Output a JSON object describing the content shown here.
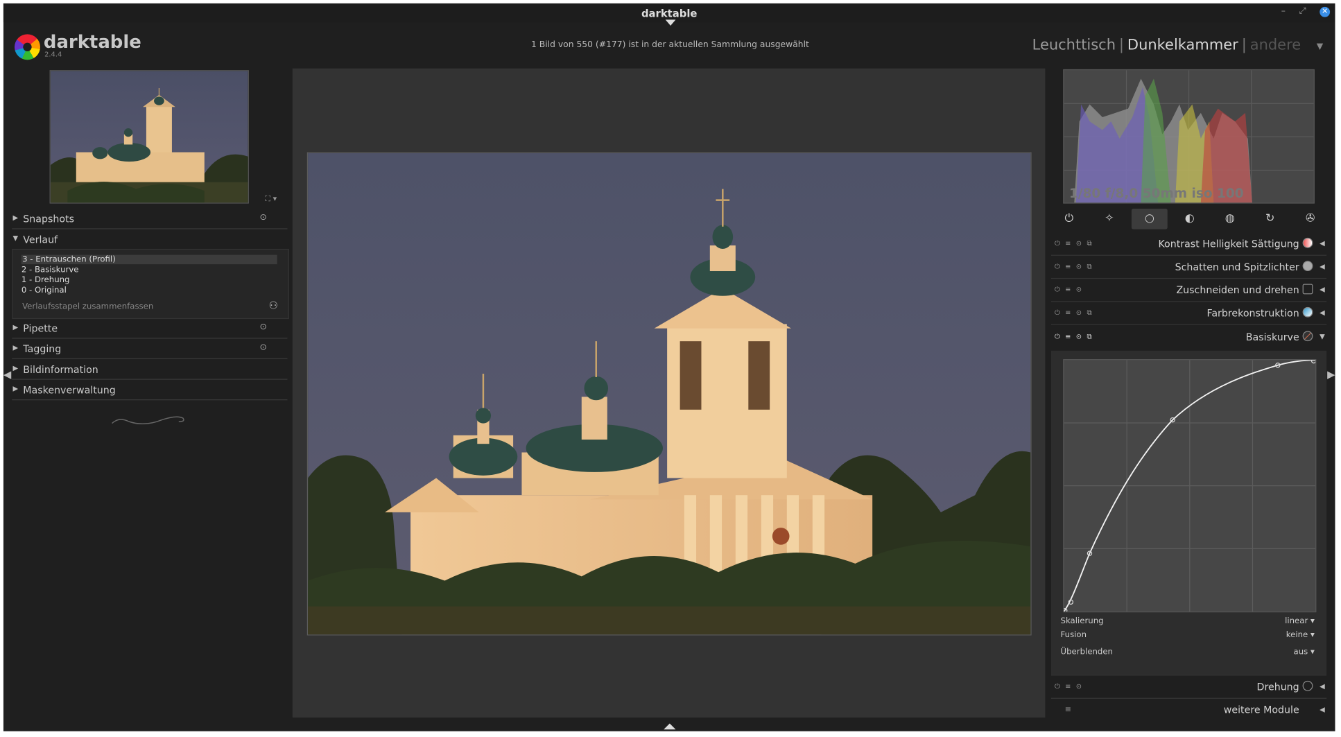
{
  "window": {
    "title": "darktable",
    "controls": [
      "–",
      "⤢",
      "✕"
    ]
  },
  "app": {
    "name": "darktable",
    "version": "2.4.4"
  },
  "status": "1 Bild von 550 (#177) ist in der aktuellen Sammlung ausgewählt",
  "views": {
    "lighttable": "Leuchttisch",
    "darkroom": "Dunkelkammer",
    "other": "andere",
    "sep": "|"
  },
  "left_panel": {
    "thumb_toggle": "⛶ ▾",
    "sections": {
      "snapshots": "Snapshots",
      "history": "Verlauf",
      "colorpicker": "Pipette",
      "tagging": "Tagging",
      "imageinfo": "Bildinformation",
      "masks": "Maskenverwaltung"
    },
    "history_items": [
      "3 - Entrauschen (Profil)",
      "2 - Basiskurve",
      "1 - Drehung",
      "0 - Original"
    ],
    "compress_label": "Verlaufsstapel zusammenfassen"
  },
  "right_panel": {
    "exif": "1/80 f/8,0 50mm iso 100",
    "modules": {
      "contrast": "Kontrast Helligkeit Sättigung",
      "shadows": "Schatten und Spitzlichter",
      "crop": "Zuschneiden und drehen",
      "colorrecon": "Farbrekonstruktion",
      "basecurve": "Basiskurve",
      "rotation": "Drehung",
      "more": "weitere Module"
    },
    "basecurve_options": {
      "scale_label": "Skalierung",
      "scale_value": "linear",
      "fusion_label": "Fusion",
      "fusion_value": "keine",
      "blend_label": "Überblenden",
      "blend_value": "aus"
    }
  },
  "colors": {
    "accent": "#3a8ee6",
    "panel": "#1f1f1f",
    "center": "#333333"
  }
}
